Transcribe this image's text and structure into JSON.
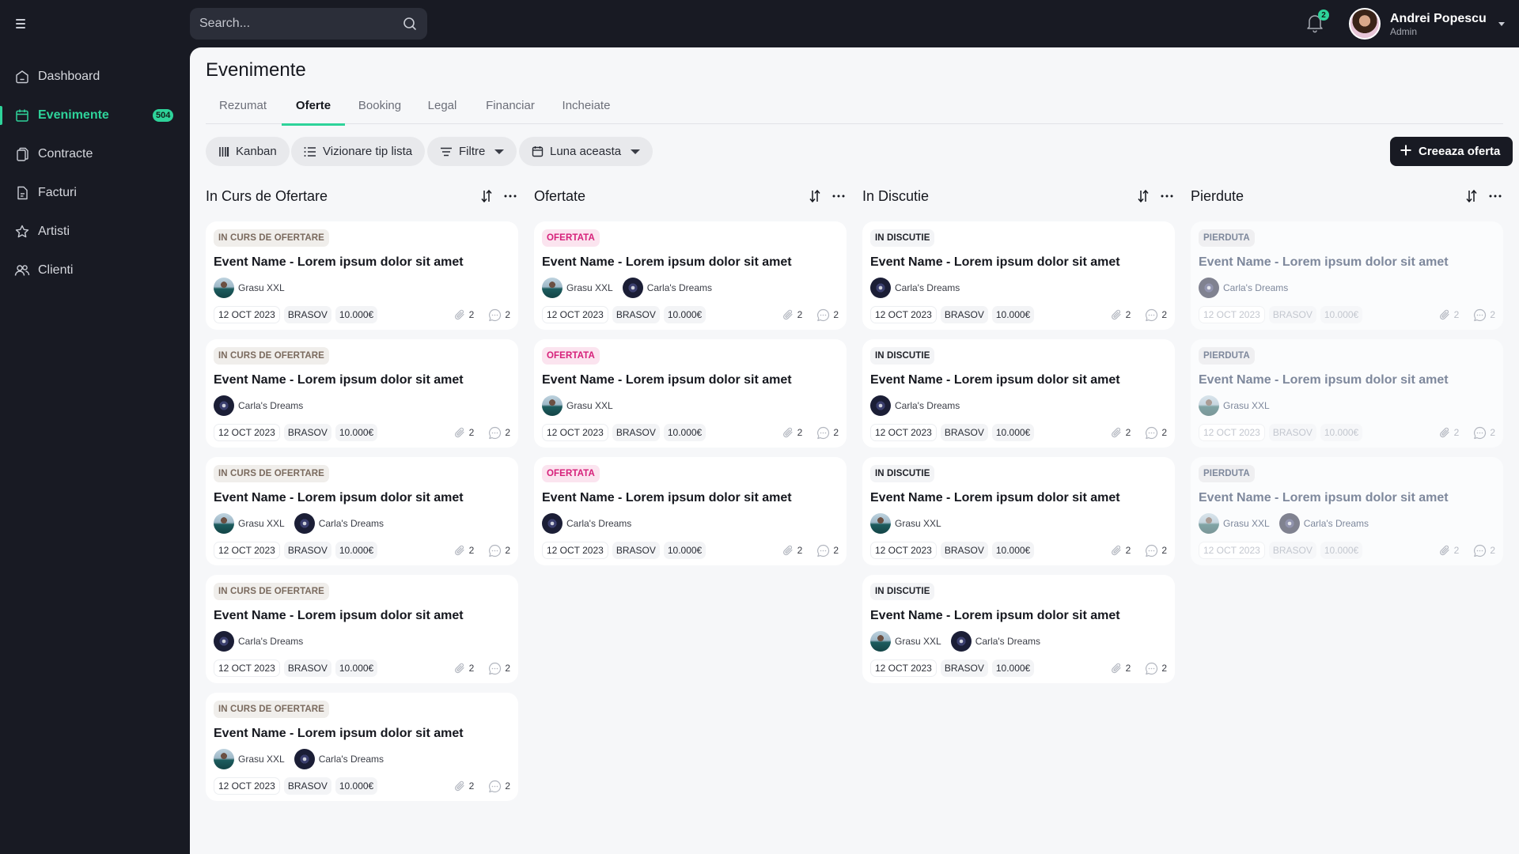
{
  "topbar": {
    "menu_icon": "hamburger-icon",
    "search": {
      "placeholder": "Search...",
      "value": "",
      "icon": "search-icon"
    },
    "notifications": {
      "icon": "bell-icon",
      "count": "2"
    },
    "user": {
      "name": "Andrei Popescu",
      "role": "Admin",
      "menu_icon": "chevron-down-icon"
    }
  },
  "sidebar": {
    "items": [
      {
        "label": "Dashboard",
        "icon": "home-icon",
        "active": false
      },
      {
        "label": "Evenimente",
        "icon": "calendar-icon",
        "active": true,
        "count": "504"
      },
      {
        "label": "Contracte",
        "icon": "documents-icon",
        "active": false
      },
      {
        "label": "Facturi",
        "icon": "invoice-icon",
        "active": false
      },
      {
        "label": "Artisti",
        "icon": "star-icon",
        "active": false
      },
      {
        "label": "Clienti",
        "icon": "users-icon",
        "active": false
      }
    ]
  },
  "page": {
    "title": "Evenimente",
    "tabs": [
      {
        "label": "Rezumat",
        "active": false
      },
      {
        "label": "Oferte",
        "active": true
      },
      {
        "label": "Booking",
        "active": false
      },
      {
        "label": "Legal",
        "active": false
      },
      {
        "label": "Financiar",
        "active": false
      },
      {
        "label": "Incheiate",
        "active": false
      }
    ],
    "toolbar": {
      "kanban": "Kanban",
      "list_view": "Vizionare tip lista",
      "filters": "Filtre",
      "period": "Luna aceasta",
      "create": "Creeaza oferta"
    }
  },
  "colors": {
    "accent": "#2ed39a",
    "sidebar_bg": "#181a23",
    "panel_bg": "#f6f7f9",
    "status_curs": "#7a6a5e",
    "status_ofertata": "#d6207a",
    "status_discutie": "#1e2027",
    "status_pierduta": "#7e889c"
  },
  "columns": [
    {
      "title": "In Curs de Ofertare",
      "status_class": "curs",
      "cards": [
        {
          "status": "IN CURS DE OFERTARE",
          "title": "Event Name - Lorem ipsum dolor sit amet",
          "artists": [
            "Grasu XXL"
          ],
          "date": "12 OCT 2023",
          "location": "BRASOV",
          "price": "10.000€",
          "attachments": "2",
          "comments": "2"
        },
        {
          "status": "IN CURS DE OFERTARE",
          "title": "Event Name - Lorem ipsum dolor sit amet",
          "artists": [
            "Carla's Dreams"
          ],
          "date": "12 OCT 2023",
          "location": "BRASOV",
          "price": "10.000€",
          "attachments": "2",
          "comments": "2"
        },
        {
          "status": "IN CURS DE OFERTARE",
          "title": "Event Name - Lorem ipsum dolor sit amet",
          "artists": [
            "Grasu XXL",
            "Carla's Dreams"
          ],
          "date": "12 OCT 2023",
          "location": "BRASOV",
          "price": "10.000€",
          "attachments": "2",
          "comments": "2"
        },
        {
          "status": "IN CURS DE OFERTARE",
          "title": "Event Name - Lorem ipsum dolor sit amet",
          "artists": [
            "Carla's Dreams"
          ],
          "date": "12 OCT 2023",
          "location": "BRASOV",
          "price": "10.000€",
          "attachments": "2",
          "comments": "2"
        },
        {
          "status": "IN CURS DE OFERTARE",
          "title": "Event Name - Lorem ipsum dolor sit amet",
          "artists": [
            "Grasu XXL",
            "Carla's Dreams"
          ],
          "date": "12 OCT 2023",
          "location": "BRASOV",
          "price": "10.000€",
          "attachments": "2",
          "comments": "2"
        }
      ]
    },
    {
      "title": "Ofertate",
      "status_class": "ofertata",
      "cards": [
        {
          "status": "OFERTATA",
          "title": "Event Name - Lorem ipsum dolor sit amet",
          "artists": [
            "Grasu XXL",
            "Carla's Dreams"
          ],
          "date": "12 OCT 2023",
          "location": "BRASOV",
          "price": "10.000€",
          "attachments": "2",
          "comments": "2"
        },
        {
          "status": "OFERTATA",
          "title": "Event Name - Lorem ipsum dolor sit amet",
          "artists": [
            "Grasu XXL"
          ],
          "date": "12 OCT 2023",
          "location": "BRASOV",
          "price": "10.000€",
          "attachments": "2",
          "comments": "2"
        },
        {
          "status": "OFERTATA",
          "title": "Event Name - Lorem ipsum dolor sit amet",
          "artists": [
            "Carla's Dreams"
          ],
          "date": "12 OCT 2023",
          "location": "BRASOV",
          "price": "10.000€",
          "attachments": "2",
          "comments": "2"
        }
      ]
    },
    {
      "title": "In Discutie",
      "status_class": "discutie",
      "cards": [
        {
          "status": "IN DISCUTIE",
          "title": "Event Name - Lorem ipsum dolor sit amet",
          "artists": [
            "Carla's Dreams"
          ],
          "date": "12 OCT 2023",
          "location": "BRASOV",
          "price": "10.000€",
          "attachments": "2",
          "comments": "2"
        },
        {
          "status": "IN DISCUTIE",
          "title": "Event Name - Lorem ipsum dolor sit amet",
          "artists": [
            "Carla's Dreams"
          ],
          "date": "12 OCT 2023",
          "location": "BRASOV",
          "price": "10.000€",
          "attachments": "2",
          "comments": "2"
        },
        {
          "status": "IN DISCUTIE",
          "title": "Event Name - Lorem ipsum dolor sit amet",
          "artists": [
            "Grasu XXL"
          ],
          "date": "12 OCT 2023",
          "location": "BRASOV",
          "price": "10.000€",
          "attachments": "2",
          "comments": "2"
        },
        {
          "status": "IN DISCUTIE",
          "title": "Event Name - Lorem ipsum dolor sit amet",
          "artists": [
            "Grasu XXL",
            "Carla's Dreams"
          ],
          "date": "12 OCT 2023",
          "location": "BRASOV",
          "price": "10.000€",
          "attachments": "2",
          "comments": "2"
        }
      ]
    },
    {
      "title": "Pierdute",
      "status_class": "pierduta",
      "cards": [
        {
          "status": "PIERDUTA",
          "title": "Event Name - Lorem ipsum dolor sit amet",
          "artists": [
            "Carla's Dreams"
          ],
          "date": "12 OCT 2023",
          "location": "BRASOV",
          "price": "10.000€",
          "attachments": "2",
          "comments": "2"
        },
        {
          "status": "PIERDUTA",
          "title": "Event Name - Lorem ipsum dolor sit amet",
          "artists": [
            "Grasu XXL"
          ],
          "date": "12 OCT 2023",
          "location": "BRASOV",
          "price": "10.000€",
          "attachments": "2",
          "comments": "2"
        },
        {
          "status": "PIERDUTA",
          "title": "Event Name - Lorem ipsum dolor sit amet",
          "artists": [
            "Grasu XXL",
            "Carla's Dreams"
          ],
          "date": "12 OCT 2023",
          "location": "BRASOV",
          "price": "10.000€",
          "attachments": "2",
          "comments": "2"
        }
      ]
    }
  ]
}
